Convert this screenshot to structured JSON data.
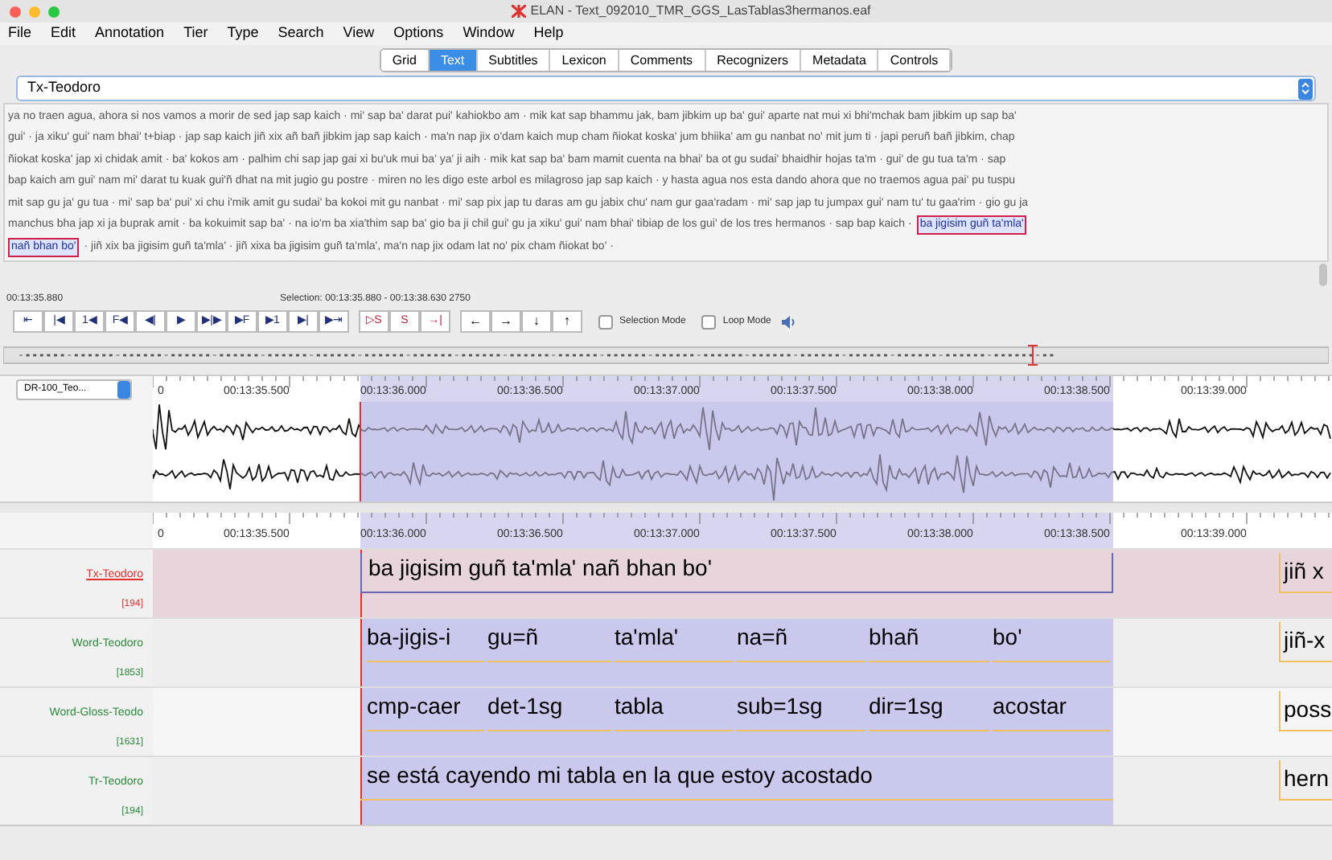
{
  "window": {
    "title": "ELAN - Text_092010_TMR_GGS_LasTablas3hermanos.eaf"
  },
  "menu": [
    "File",
    "Edit",
    "Annotation",
    "Tier",
    "Type",
    "Search",
    "View",
    "Options",
    "Window",
    "Help"
  ],
  "tabs": [
    {
      "label": "Grid",
      "selected": false
    },
    {
      "label": "Text",
      "selected": true
    },
    {
      "label": "Subtitles",
      "selected": false
    },
    {
      "label": "Lexicon",
      "selected": false
    },
    {
      "label": "Comments",
      "selected": false
    },
    {
      "label": "Recognizers",
      "selected": false
    },
    {
      "label": "Metadata",
      "selected": false
    },
    {
      "label": "Controls",
      "selected": false
    }
  ],
  "tier_select": {
    "value": "Tx-Teodoro"
  },
  "transcript": {
    "lines": [
      {
        "segments": [
          {
            "text": "ya no traen agua, ahora si nos vamos a morir de sed jap sap kaich · mi' sap ba' darat pui' kahiokbo am · mik kat sap bhammu jak, bam jibkim up ba' gui' aparte nat mui xi bhi'mchak bam jibkim up sap ba'",
            "selected": false
          }
        ]
      },
      {
        "segments": [
          {
            "text": "gui' · ja xiku' gui' nam bhai' t+biap · jap sap kaich jiñ xix añ bañ jibkim jap sap kaich · ma'n nap jix o'dam kaich mup cham ñiokat koska' jum bhiika' am gu nanbat no' mit jum ti · japi peruñ bañ jibkim, chap",
            "selected": false
          }
        ]
      },
      {
        "segments": [
          {
            "text": "ñiokat koska' jap xi chidak amit · ba' kokos am · palhim chi sap jap gai xi bu'uk mui ba' ya' ji aih · mik kat sap ba' bam mamit cuenta na bhai' ba ot gu sudai' bhaidhir hojas ta'm · gui' de gu tua ta'm · sap",
            "selected": false
          }
        ]
      },
      {
        "segments": [
          {
            "text": "bap kaich am gui' nam mi' darat tu kuak gui'ñ dhat na mit jugio gu postre · miren no les digo este arbol es milagroso jap sap kaich · y hasta agua nos esta dando ahora que no traemos agua pai' pu tuspu",
            "selected": false
          }
        ]
      },
      {
        "segments": [
          {
            "text": "mit sap gu ja' gu tua · mi' sap ba' pui' xi chu i'mik amit gu sudai' ba kokoi mit gu nanbat · mi' sap pix jap tu daras am gu jabix chu' nam gur gaa'radam · mi' sap jap tu jumpax gui' nam tu' tu gaa'rim · gio gu ja",
            "selected": false
          }
        ]
      },
      {
        "segments": [
          {
            "text": "manchus bha jap xi ja buprak amit · ba kokuimit sap ba' · na io'm ba xia'thim sap ba' gio ba ji chil gui' gu ja xiku' gui' nam bhai' tibiap de los gui' de los tres hermanos · sap bap kaich ·",
            "selected": false
          },
          {
            "text": "ba jigisim guñ ta'mla'",
            "selected": true
          }
        ]
      },
      {
        "segments": [
          {
            "text": "nañ bhan bo'",
            "selected": true
          },
          {
            "text": "· jiñ xix ba jigisim guñ ta'mla' · jiñ xixa ba jigisim guñ ta'mla', ma'n nap jix odam lat no' pix cham ñiokat bo' ·",
            "selected": false
          }
        ]
      }
    ]
  },
  "media": {
    "time": "00:13:35.880",
    "selection": "Selection: 00:13:35.880 - 00:13:38.630  2750",
    "play_buttons": [
      "⇤",
      "|◀",
      "1◀",
      "F◀",
      "◀|",
      "▶",
      "▶|▶",
      "▶F",
      "▶1",
      "▶|",
      "▶⇥"
    ],
    "selection_buttons": [
      "▷S",
      "S",
      "→|"
    ],
    "nav_buttons": [
      "←",
      "→",
      "↓",
      "↑"
    ],
    "options": [
      {
        "label": "Selection Mode",
        "checked": false
      },
      {
        "label": "Loop Mode",
        "checked": false
      }
    ]
  },
  "waveform": {
    "media_file": "DR-100_Teo...",
    "ruler": [
      "0",
      "00:13:35.500",
      "00:13:36.000",
      "00:13:36.500",
      "00:13:37.000",
      "00:13:37.500",
      "00:13:38.000",
      "00:13:38.500",
      "00:13:39.000"
    ]
  },
  "timeline": {
    "ruler": [
      "0",
      "00:13:35.500",
      "00:13:36.000",
      "00:13:36.500",
      "00:13:37.000",
      "00:13:37.500",
      "00:13:38.000",
      "00:13:38.500",
      "00:13:39.000"
    ],
    "tiers": [
      {
        "name": "Tx-Teodoro",
        "count": "[194]",
        "active": true,
        "annotations": [
          "ba jigisim guñ ta'mla' nañ bhan bo'"
        ],
        "next": "jiñ x"
      },
      {
        "name": "Word-Teodoro",
        "count": "[1853]",
        "active": false,
        "annotations": [
          "ba-jigis-i",
          "gu=ñ",
          "ta'mla'",
          "na=ñ",
          "bhañ",
          "bo'"
        ],
        "next": "jiñ-x"
      },
      {
        "name": "Word-Gloss-Teodo",
        "count": "[1631]",
        "active": false,
        "annotations": [
          "cmp-caer",
          "det-1sg",
          "tabla",
          "sub=1sg",
          "dir=1sg",
          "acostar"
        ],
        "next": "poss"
      },
      {
        "name": "Tr-Teodoro",
        "count": "[194]",
        "active": false,
        "annotations": [
          "se está cayendo mi tabla en la que estoy acostado"
        ],
        "next": "hern"
      }
    ]
  }
}
